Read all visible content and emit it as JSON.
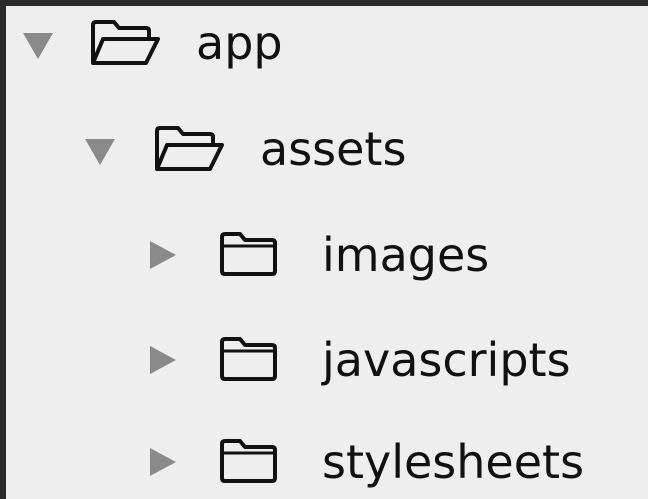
{
  "tree": {
    "items": [
      {
        "label": "app",
        "expanded": true,
        "icon": "folder-open-icon",
        "disclosure": "triangle-down-icon"
      },
      {
        "label": "assets",
        "expanded": true,
        "icon": "folder-open-icon",
        "disclosure": "triangle-down-icon"
      },
      {
        "label": "images",
        "expanded": false,
        "icon": "folder-icon",
        "disclosure": "triangle-right-icon"
      },
      {
        "label": "javascripts",
        "expanded": false,
        "icon": "folder-icon",
        "disclosure": "triangle-right-icon"
      },
      {
        "label": "stylesheets",
        "expanded": false,
        "icon": "folder-icon",
        "disclosure": "triangle-right-icon"
      }
    ]
  },
  "colors": {
    "background": "#2b2b2b",
    "panel": "#eeeeee",
    "disclosure": "#8a8a8a",
    "text": "#111111"
  }
}
